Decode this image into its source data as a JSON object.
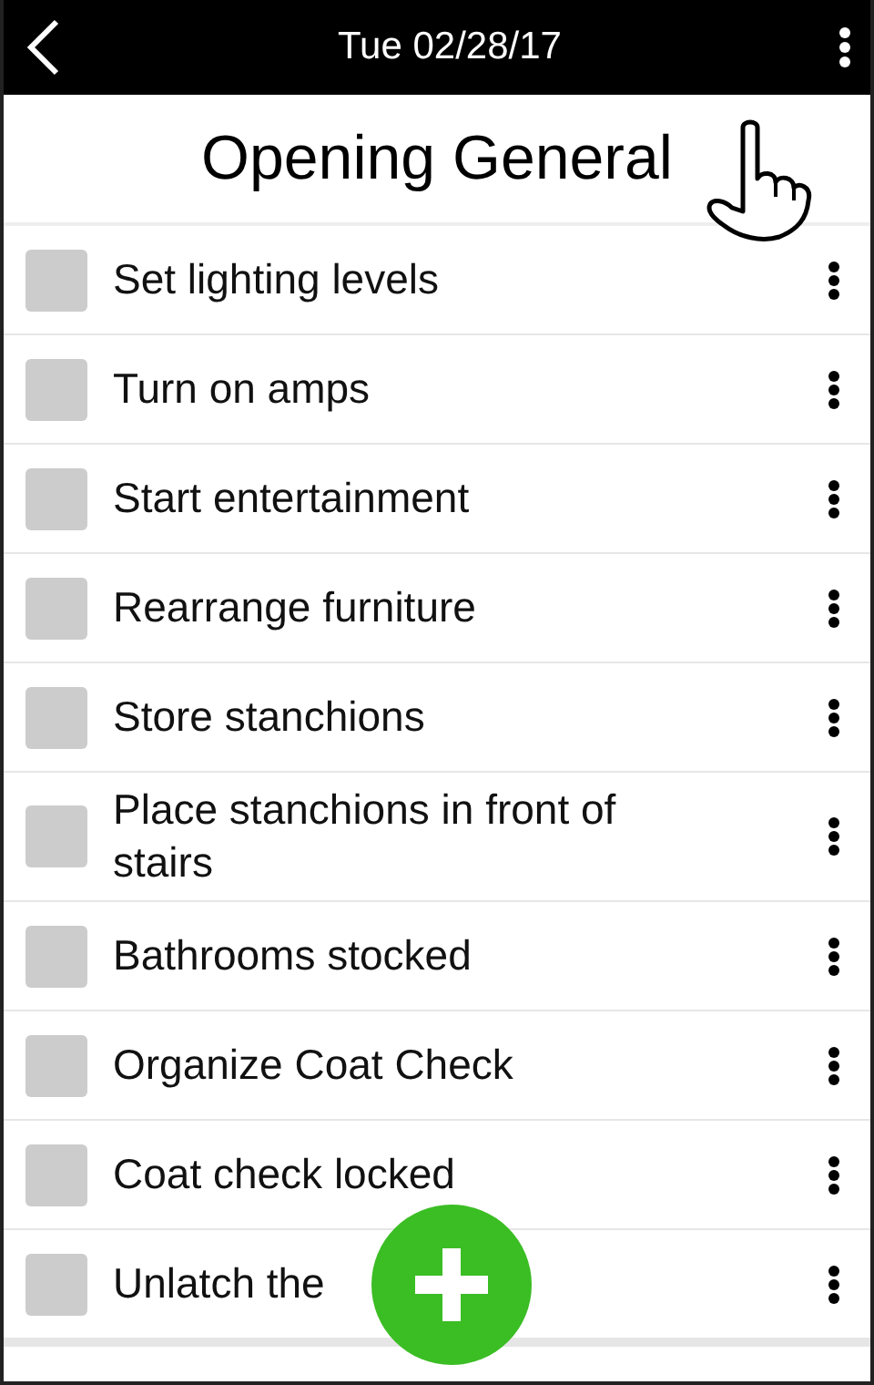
{
  "header": {
    "title": "Tue 02/28/17"
  },
  "list_title": "Opening General",
  "tasks": [
    {
      "label": "Set lighting levels",
      "checked": false
    },
    {
      "label": "Turn on amps",
      "checked": false
    },
    {
      "label": "Start entertainment",
      "checked": false
    },
    {
      "label": "Rearrange furniture",
      "checked": false
    },
    {
      "label": "Store stanchions",
      "checked": false
    },
    {
      "label": "Place stanchions in front of stairs",
      "checked": false
    },
    {
      "label": "Bathrooms stocked",
      "checked": false
    },
    {
      "label": "Organize Coat Check",
      "checked": false
    },
    {
      "label": "Coat check locked",
      "checked": false
    },
    {
      "label": "Unlatch the",
      "checked": false
    }
  ]
}
